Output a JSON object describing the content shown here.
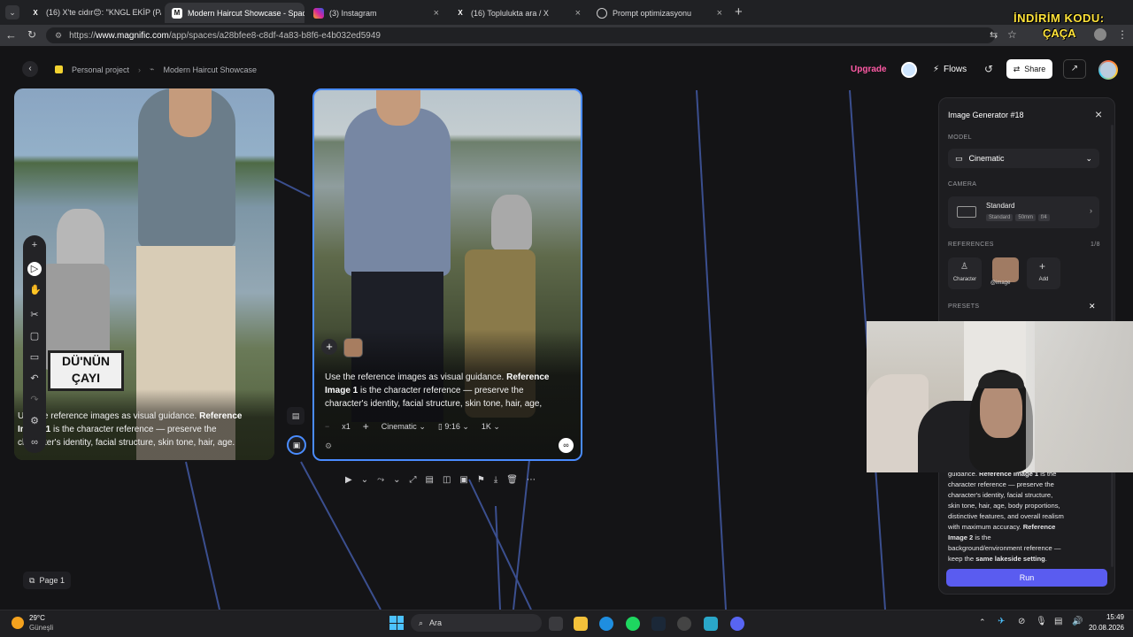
{
  "tabs": [
    {
      "title": "(16) X'te cidır😊: \"KNGL EKİP (PAR",
      "favicon": "X",
      "active": false
    },
    {
      "title": "Modern Haircut Showcase - Space",
      "favicon": "M",
      "active": true
    },
    {
      "title": "(3) Instagram",
      "favicon": "ig",
      "active": false
    },
    {
      "title": "(16) Toplulukta ara / X",
      "favicon": "X",
      "active": false
    },
    {
      "title": "Prompt optimizasyonu",
      "favicon": "◯",
      "active": false
    }
  ],
  "address": {
    "prefix": "https://",
    "domain": "www.magnific.com",
    "path": "/app/spaces/a28bfee8-c8df-4a83-b8f6-e4b032ed5949"
  },
  "promo": {
    "line1": "İNDİRİM KODU:",
    "line2": "ÇAÇA"
  },
  "header": {
    "project": "Personal project",
    "space": "Modern Haircut Showcase",
    "upgrade": "Upgrade",
    "flows": "Flows",
    "share": "Share"
  },
  "node_left": {
    "prompt_parts": [
      "Use the reference images as visual guidance. ",
      "Reference Image 1",
      " is the character reference — preserve the character's identity, facial structure, skin tone, hair, age."
    ],
    "sign": [
      "DÜ'NÜN",
      "ÇAYI"
    ]
  },
  "node_right": {
    "prompt_l1a": "Use the reference images as visual guidance. ",
    "prompt_l1b": "Reference",
    "prompt_l2a": "Image 1",
    "prompt_l2b": " is the character reference — preserve the",
    "prompt_l3": "character's identity, facial structure, skin tone, hair, age,",
    "count": "x1",
    "model": "Cinematic",
    "ratio": "9:16",
    "resolution": "1K"
  },
  "panel": {
    "title": "Image Generator #18",
    "model_label": "MODEL",
    "model_value": "Cinematic",
    "camera_label": "CAMERA",
    "camera_value": "Standard",
    "camera_tags": [
      "Standard",
      "50mm",
      "f/4"
    ],
    "references_label": "REFERENCES",
    "references_count": "1/8",
    "ref_character": "Character",
    "ref_image": "@image",
    "ref_add": "Add",
    "presets_label": "PRESETS",
    "prompt_lines": [
      {
        "t": "guidance. ",
        "b": "Reference Image 1",
        "r": " is the"
      },
      {
        "t": "character reference — preserve the"
      },
      {
        "t": "character's identity, facial structure,"
      },
      {
        "t": "skin tone, hair, age, body proportions,"
      },
      {
        "t": "distinctive features, and overall realism"
      },
      {
        "t": "with maximum accuracy. ",
        "b": "Reference"
      },
      {
        "b": "Image 2",
        "r": " is the"
      },
      {
        "t": "background/environment reference —"
      },
      {
        "t": "keep the ",
        "b": "same lakeside setting",
        "r": "."
      }
    ],
    "run": "Run"
  },
  "page": "Page 1",
  "taskbar": {
    "weather_temp": "29°C",
    "weather_desc": "Güneşli",
    "search": "Ara",
    "time": "15:49",
    "date": "20.08.2026"
  },
  "colors": {
    "accent": "#5a5cf0",
    "upgrade": "#ff5aa5",
    "selection": "#4a8cff"
  }
}
